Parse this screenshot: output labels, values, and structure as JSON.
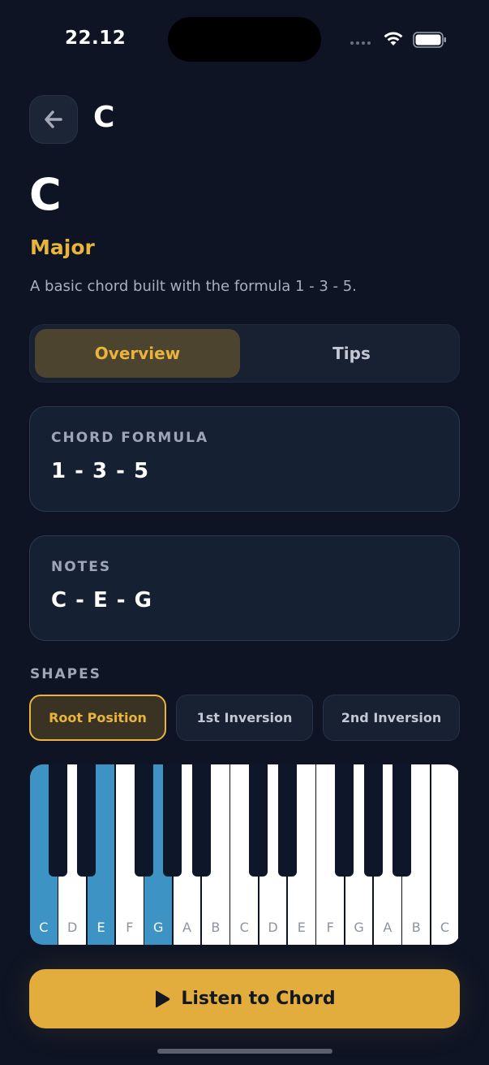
{
  "status_bar": {
    "time": "22.12"
  },
  "header": {
    "title": "C"
  },
  "chord": {
    "name": "C",
    "quality": "Major",
    "description": "A basic chord built with the formula 1 - 3 - 5."
  },
  "tabs": [
    {
      "label": "Overview",
      "selected": true
    },
    {
      "label": "Tips",
      "selected": false
    }
  ],
  "formula_card": {
    "label": "CHORD FORMULA",
    "value": "1 - 3 - 5"
  },
  "notes_card": {
    "label": "NOTES",
    "value": "C - E - G"
  },
  "shapes": {
    "label": "SHAPES",
    "options": [
      {
        "label": "Root Position",
        "selected": true
      },
      {
        "label": "1st Inversion",
        "selected": false
      },
      {
        "label": "2nd Inversion",
        "selected": false
      }
    ]
  },
  "piano": {
    "white_keys": [
      "C",
      "D",
      "E",
      "F",
      "G",
      "A",
      "B",
      "C",
      "D",
      "E",
      "F",
      "G",
      "A",
      "B",
      "C"
    ],
    "active_indices": [
      0,
      2,
      4
    ],
    "black_after_indices": [
      0,
      1,
      3,
      4,
      5,
      7,
      8,
      10,
      11,
      12
    ],
    "active_color": "#3d94c4"
  },
  "listen_button": {
    "label": "Listen to Chord",
    "icon": "play-icon"
  },
  "colors": {
    "accent": "#e8b43c",
    "background": "#0e1424",
    "highlight": "#3d94c4"
  }
}
